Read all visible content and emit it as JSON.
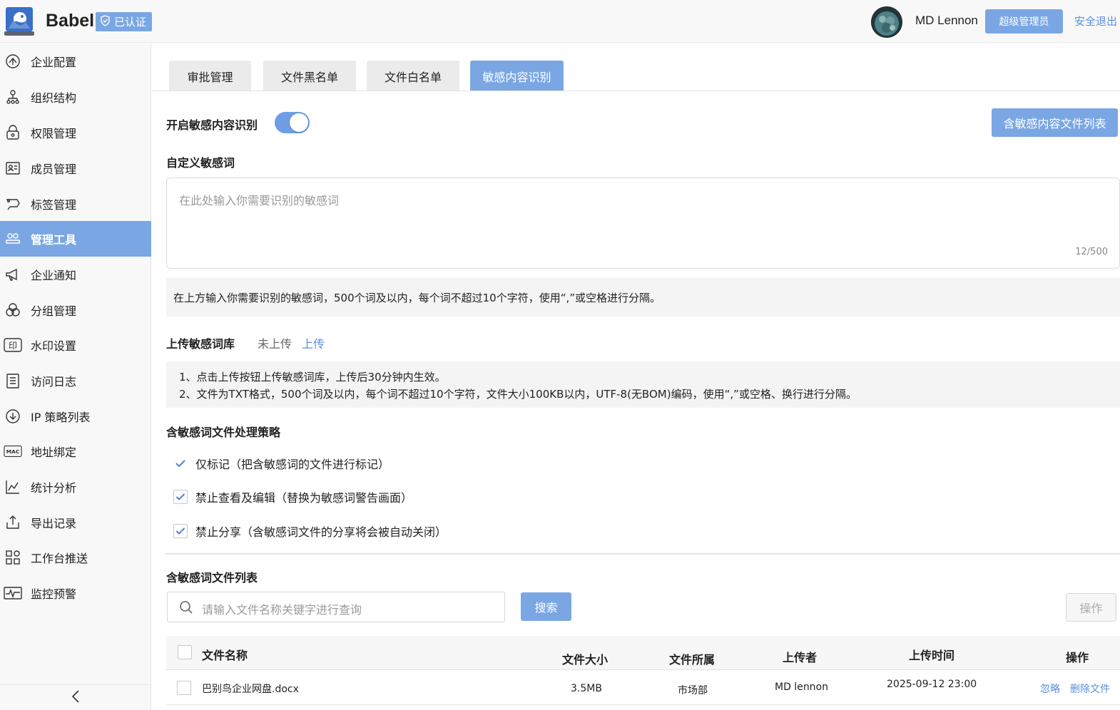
{
  "header": {
    "brand": "Babel",
    "verified_label": "已认证",
    "username": "MD Lennon",
    "role_label": "超级管理员",
    "logout_label": "安全退出"
  },
  "sidebar": {
    "active_item": "管理工具",
    "items": [
      {
        "label": "企业配置",
        "icon": "enterprise-config-icon"
      },
      {
        "label": "组织结构",
        "icon": "org-structure-icon"
      },
      {
        "label": "权限管理",
        "icon": "permission-icon"
      },
      {
        "label": "成员管理",
        "icon": "member-card-icon"
      },
      {
        "label": "标签管理",
        "icon": "tag-icon"
      },
      {
        "label": "管理工具",
        "icon": "admin-tools-icon"
      },
      {
        "label": "企业通知",
        "icon": "megaphone-icon"
      },
      {
        "label": "分组管理",
        "icon": "group-circles-icon"
      },
      {
        "label": "水印设置",
        "icon": "watermark-icon"
      },
      {
        "label": "访问日志",
        "icon": "log-list-icon"
      },
      {
        "label": "IP 策略列表",
        "icon": "ip-policy-icon"
      },
      {
        "label": "地址绑定",
        "icon": "mac-binding-icon"
      },
      {
        "label": "统计分析",
        "icon": "stats-chart-icon"
      },
      {
        "label": "导出记录",
        "icon": "export-icon"
      },
      {
        "label": "工作台推送",
        "icon": "workbench-grid-icon"
      },
      {
        "label": "监控预警",
        "icon": "monitor-pulse-icon"
      }
    ]
  },
  "tabs": [
    {
      "label": "审批管理",
      "active": false
    },
    {
      "label": "文件黑名单",
      "active": false
    },
    {
      "label": "文件白名单",
      "active": false
    },
    {
      "label": "敏感内容识别",
      "active": true
    }
  ],
  "settings": {
    "enable_label": "开启敏感内容识别",
    "enabled": true,
    "list_button": "含敏感内容文件列表",
    "custom_words_label": "自定义敏感词",
    "custom_words_placeholder": "在此处输入你需要识别的敏感词",
    "counter": "12/500",
    "custom_words_hint": "在上方输入你需要识别的敏感词，500个词及以内，每个词不超过10个字符，使用“,”或空格进行分隔。",
    "upload_label": "上传敏感词库",
    "upload_status": "未上传",
    "upload_link": "上传",
    "upload_hint_1": "1、点击上传按钮上传敏感词库，上传后30分钟内生效。",
    "upload_hint_2": "2、文件为TXT格式，500个词及以内，每个词不超过10个字符，文件大小100KB以内，UTF-8(无BOM)编码，使用“,”或空格、换行进行分隔。",
    "policy_label": "含敏感词文件处理策略",
    "policies": [
      {
        "label": "仅标记（把含敏感词的文件进行标记）",
        "checked": true
      },
      {
        "label": "禁止查看及编辑（替换为敏感词警告画面）",
        "checked": true
      },
      {
        "label": "禁止分享（含敏感词文件的分享将会被自动关闭）",
        "checked": true
      }
    ]
  },
  "file_list": {
    "title": "含敏感词文件列表",
    "search_placeholder": "请输入文件名称关键字进行查询",
    "search_button": "搜索",
    "op_button": "操作",
    "columns": {
      "name": "文件名称",
      "size": "文件大小",
      "dept": "文件所属",
      "uploader": "上传者",
      "time": "上传时间",
      "ops": "操作"
    },
    "rows": [
      {
        "name": "巴别鸟企业网盘.docx",
        "size": "3.5MB",
        "dept": "市场部",
        "uploader": "MD lennon",
        "time": "2025-09-12 23:00",
        "action_ignore": "忽略",
        "action_delete": "删除文件"
      }
    ]
  },
  "colors": {
    "accent": "#7aa7e3",
    "link": "#5b90dd",
    "sidebar_bg": "#f8f8f8"
  }
}
